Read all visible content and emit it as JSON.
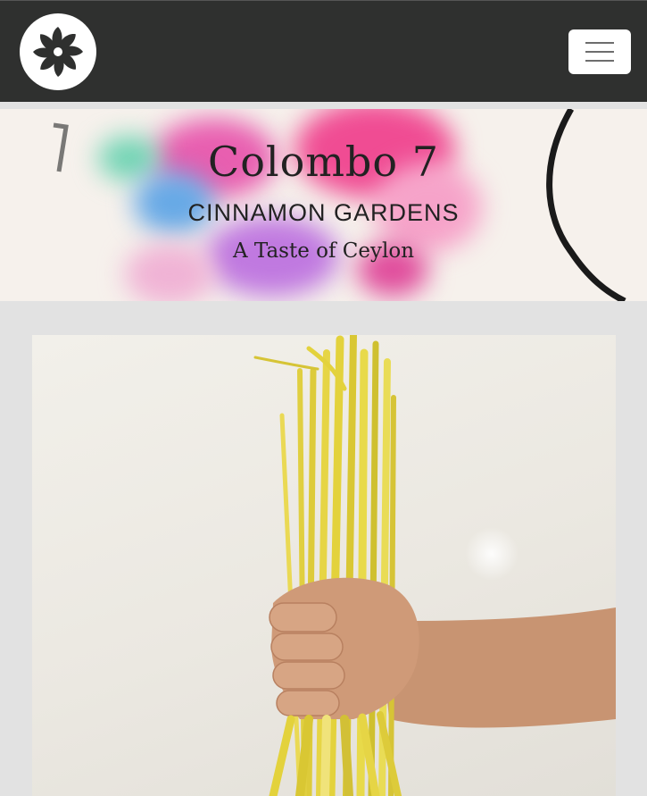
{
  "header": {
    "logo_icon": "flower-pinwheel-icon",
    "menu_icon": "hamburger-menu-icon"
  },
  "hero": {
    "title": "Colombo 7",
    "subtitle": "CINNAMON GARDENS",
    "tagline": "A Taste of Ceylon"
  },
  "colors": {
    "header_bg": "#2f302f",
    "page_bg": "#e2e2e2",
    "text": "#222222"
  }
}
